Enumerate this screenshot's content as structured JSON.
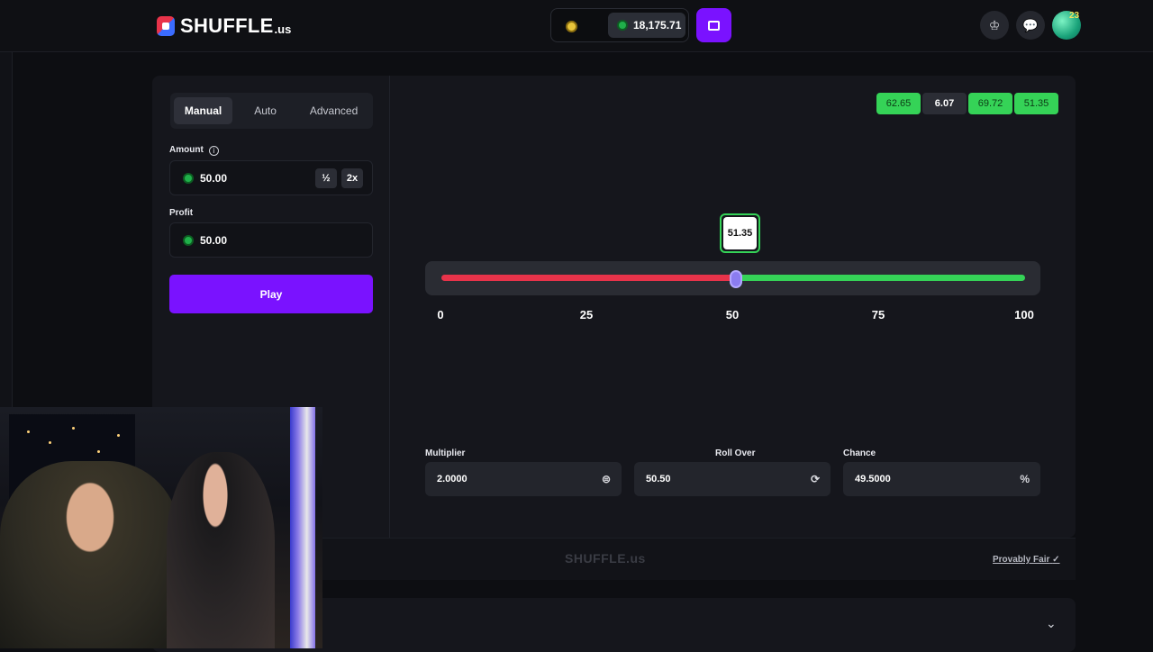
{
  "header": {
    "logo_text": "SHUFFLE",
    "logo_tld": ".us",
    "balance": "18,175.71"
  },
  "bet_panel": {
    "tabs": [
      {
        "label": "Manual",
        "active": true
      },
      {
        "label": "Auto",
        "active": false
      },
      {
        "label": "Advanced",
        "active": false
      }
    ],
    "amount_label": "Amount",
    "amount_value": "50.00",
    "half_label": "½",
    "double_label": "2x",
    "profit_label": "Profit",
    "profit_value": "50.00",
    "play_label": "Play"
  },
  "recent_results": [
    {
      "value": "62.65",
      "status": "win"
    },
    {
      "value": "6.07",
      "status": "loss"
    },
    {
      "value": "69.72",
      "status": "win"
    },
    {
      "value": "51.35",
      "status": "win"
    }
  ],
  "slider": {
    "result_marker": "51.35",
    "roll_over_value": 50.5,
    "ticks": [
      "0",
      "25",
      "50",
      "75",
      "100"
    ],
    "colors": {
      "lose": "#e8334a",
      "win": "#35d357"
    }
  },
  "controls": {
    "multiplier_label": "Multiplier",
    "multiplier_value": "2.0000",
    "roll_over_label": "Roll Over",
    "roll_over_value": "50.50",
    "chance_label": "Chance",
    "chance_value": "49.5000",
    "chance_suffix": "%"
  },
  "footer": {
    "logo_text": "SHUFFLE.us",
    "provably_fair_label": "Provably Fair"
  },
  "avatar_badge": "23",
  "colors": {
    "accent": "#7a12ff",
    "win": "#35d357",
    "lose": "#e8334a",
    "panel": "#15161c"
  }
}
